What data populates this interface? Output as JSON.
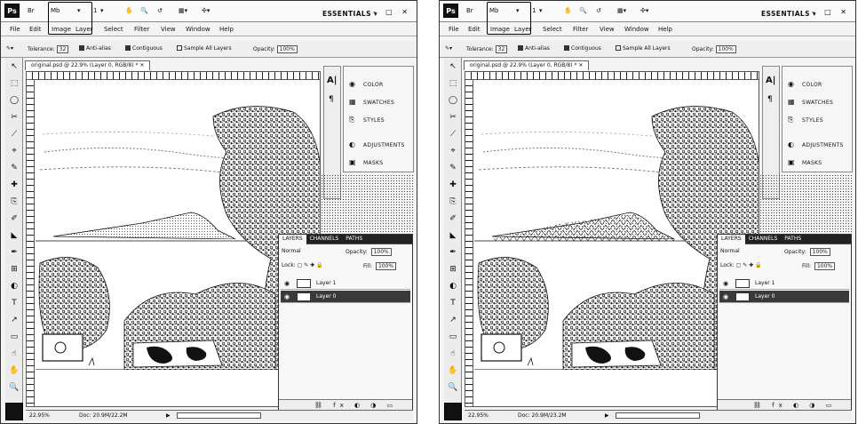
{
  "screens": [
    {
      "id": "left",
      "appbar": {
        "logo": "Ps",
        "buttons": [
          "Br",
          "Mb",
          "▾",
          "1",
          "▾",
          "✋",
          "🔍",
          "↺",
          "▦▾",
          "✣▾"
        ],
        "workspace": "ESSENTIALS ▾",
        "window_controls": "– □ ✕"
      },
      "menu": [
        "File",
        "Edit",
        "Image",
        "Layer",
        "Select",
        "Filter",
        "View",
        "Window",
        "Help"
      ],
      "options": {
        "tool_icon": "✎▾",
        "tolerance_label": "Tolerance:",
        "tolerance_value": "32",
        "anti_alias": "Anti-alias",
        "contiguous": "Contiguous",
        "sample_all": "Sample All Layers",
        "opacity_label": "Opacity:",
        "opacity_value": "100%"
      },
      "doc_tab": "original.psd @ 22.9% (Layer 0, RGB/8) * ✕",
      "panels": [
        {
          "icon": "◉",
          "label": "COLOR"
        },
        {
          "icon": "▦",
          "label": "SWATCHES"
        },
        {
          "icon": "⎘",
          "label": "STYLES"
        },
        {
          "icon": "◐",
          "label": "ADJUSTMENTS"
        },
        {
          "icon": "▣",
          "label": "MASKS"
        }
      ],
      "layers": {
        "tabs": [
          "LAYERS",
          "CHANNELS",
          "PATHS"
        ],
        "blend": "Normal",
        "opacity_label": "Opacity:",
        "opacity_value": "100%",
        "lock_label": "Lock:",
        "fill_label": "Fill:",
        "fill_value": "100%",
        "items": [
          {
            "name": "Layer 1",
            "selected": false
          },
          {
            "name": "Layer 0",
            "selected": true
          }
        ],
        "footer": "⛓ fx ◐ ◑ ▭ ⊡ 🗑"
      },
      "status": {
        "zoom": "22.95%",
        "doc": "Doc: 20.9M/22.2M"
      },
      "water_filled": false
    },
    {
      "id": "right",
      "appbar": {
        "logo": "Ps",
        "buttons": [
          "Br",
          "Mb",
          "▾",
          "1",
          "▾",
          "✋",
          "🔍",
          "↺",
          "▦▾",
          "✣▾"
        ],
        "workspace": "ESSENTIALS ▾",
        "window_controls": "– □ ✕"
      },
      "menu": [
        "File",
        "Edit",
        "Image",
        "Layer",
        "Select",
        "Filter",
        "View",
        "Window",
        "Help"
      ],
      "options": {
        "tool_icon": "✎▾",
        "tolerance_label": "Tolerance:",
        "tolerance_value": "32",
        "anti_alias": "Anti-alias",
        "contiguous": "Contiguous",
        "sample_all": "Sample All Layers",
        "opacity_label": "Opacity:",
        "opacity_value": "100%"
      },
      "doc_tab": "original.psd @ 22.9% (Layer 0, RGB/8) * ✕",
      "panels": [
        {
          "icon": "◉",
          "label": "COLOR"
        },
        {
          "icon": "▦",
          "label": "SWATCHES"
        },
        {
          "icon": "⎘",
          "label": "STYLES"
        },
        {
          "icon": "◐",
          "label": "ADJUSTMENTS"
        },
        {
          "icon": "▣",
          "label": "MASKS"
        }
      ],
      "layers": {
        "tabs": [
          "LAYERS",
          "CHANNELS",
          "PATHS"
        ],
        "blend": "Normal",
        "opacity_label": "Opacity:",
        "opacity_value": "100%",
        "lock_label": "Lock:",
        "fill_label": "Fill:",
        "fill_value": "100%",
        "items": [
          {
            "name": "Layer 1",
            "selected": false
          },
          {
            "name": "Layer 0",
            "selected": true
          }
        ],
        "footer": "⛓ fx ◐ ◑ ▭ ⊡ 🗑"
      },
      "status": {
        "zoom": "22.95%",
        "doc": "Doc: 20.9M/23.2M"
      },
      "water_filled": true
    }
  ],
  "tools": [
    "↖",
    "⬚",
    "◯",
    "✂",
    "⟋",
    "⌖",
    "✎",
    "✚",
    "⎘",
    "✐",
    "◣",
    "✒",
    "⊞",
    "◐",
    "T",
    "↗",
    "▭",
    "☝",
    "✋",
    "🔍"
  ],
  "colors": {
    "chrome": "#f4f4f4",
    "ink": "#111111",
    "selection": "#3a3a3a"
  }
}
